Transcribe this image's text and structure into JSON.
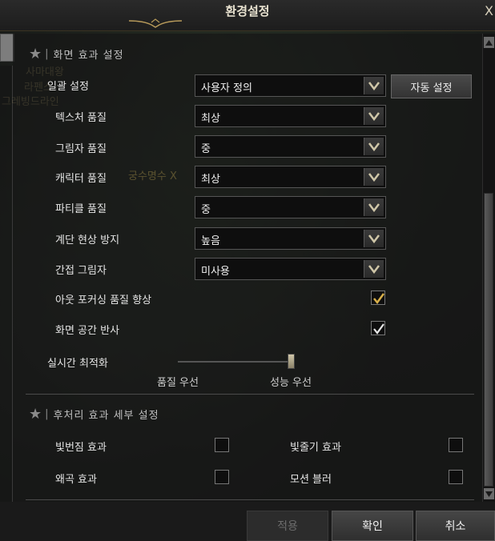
{
  "window": {
    "title": "환경설정",
    "close_label": "X"
  },
  "ghost_text": [
    "사마대왕",
    "라펜스",
    "그레빙드라인",
    "궁수명수 X"
  ],
  "section1": {
    "label": "화면 효과 설정",
    "rows": [
      {
        "label": "일괄 설정",
        "value": "사용자 정의"
      },
      {
        "label": "텍스처 품질",
        "value": "최상"
      },
      {
        "label": "그림자 품질",
        "value": "중"
      },
      {
        "label": "캐릭터 품질",
        "value": "최상"
      },
      {
        "label": "파티클 품질",
        "value": "중"
      },
      {
        "label": "계단 현상 방지",
        "value": "높음"
      },
      {
        "label": "간접 그림자",
        "value": "미사용"
      }
    ],
    "auto_button": "자동 설정",
    "checks": [
      {
        "label": "아웃 포커싱 품질 향상",
        "checked": true,
        "style": "gold"
      },
      {
        "label": "화면 공간 반사",
        "checked": true,
        "style": "white"
      }
    ],
    "slider": {
      "label": "실시간 최적화",
      "left_label": "품질 우선",
      "right_label": "성능 우선",
      "value": 1.0
    }
  },
  "section2": {
    "label": "후처리 효과 세부 설정",
    "checks": [
      {
        "label": "빛번짐 효과",
        "checked": false
      },
      {
        "label": "빛줄기 효과",
        "checked": false
      },
      {
        "label": "왜곡 효과",
        "checked": false
      },
      {
        "label": "모션 블러",
        "checked": false
      }
    ]
  },
  "footer": {
    "apply": "적용",
    "confirm": "확인",
    "cancel": "취소"
  },
  "colors": {
    "gold": "#d8b04a",
    "panel": "#161616",
    "accent_line": "#b79a5a"
  }
}
